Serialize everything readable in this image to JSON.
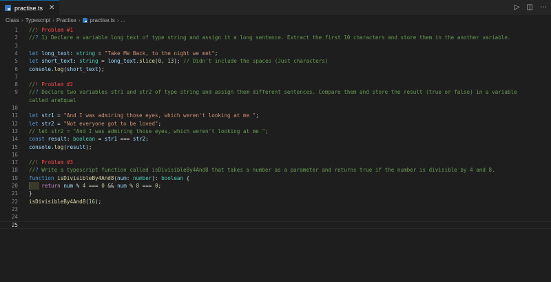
{
  "tab": {
    "label": "practise.ts",
    "close": "✕"
  },
  "breadcrumb": {
    "parts": [
      "Class",
      "Typescript",
      "Practise",
      "practise.ts",
      "..."
    ]
  },
  "colors": {
    "comment": "#6a9955",
    "keyword": "#569cd6",
    "string": "#ce9178",
    "type": "#4ec9b0",
    "function": "#dcdcaa",
    "variable": "#9cdcfe",
    "number": "#b5cea8",
    "control": "#c586c0",
    "alert": "#f44747"
  },
  "editor": {
    "active_line": 25,
    "lines": [
      {
        "n": 1,
        "tokens": [
          [
            "c",
            "//"
          ],
          [
            "b",
            "! Problem #1"
          ]
        ]
      },
      {
        "n": 2,
        "tokens": [
          [
            "c",
            "//"
          ],
          [
            "q",
            "?"
          ],
          [
            "c",
            " 1) Declare a variable long text of type string and assign it a long sentence. Extract the first 10 characters and store them in the another variable."
          ]
        ]
      },
      {
        "n": 3,
        "tokens": []
      },
      {
        "n": 4,
        "tokens": [
          [
            "k",
            "let "
          ],
          [
            "v",
            "long_text"
          ],
          [
            "p",
            ": "
          ],
          [
            "t",
            "string"
          ],
          [
            "p",
            " = "
          ],
          [
            "s",
            "\"Take Me Back, to the night we met\""
          ],
          [
            "p",
            ";"
          ]
        ]
      },
      {
        "n": 5,
        "tokens": [
          [
            "k",
            "let "
          ],
          [
            "v",
            "short_text"
          ],
          [
            "p",
            ": "
          ],
          [
            "t",
            "string"
          ],
          [
            "p",
            " = "
          ],
          [
            "v",
            "long_text"
          ],
          [
            "p",
            "."
          ],
          [
            "f",
            "slice"
          ],
          [
            "p",
            "("
          ],
          [
            "n",
            "0"
          ],
          [
            "p",
            ", "
          ],
          [
            "n",
            "13"
          ],
          [
            "p",
            "); "
          ],
          [
            "c",
            "// Didn't include the spaces (Just characters)"
          ]
        ]
      },
      {
        "n": 6,
        "tokens": [
          [
            "v",
            "console"
          ],
          [
            "p",
            "."
          ],
          [
            "f",
            "log"
          ],
          [
            "p",
            "("
          ],
          [
            "v",
            "short_text"
          ],
          [
            "p",
            ");"
          ]
        ]
      },
      {
        "n": 7,
        "tokens": []
      },
      {
        "n": 8,
        "tokens": [
          [
            "c",
            "//"
          ],
          [
            "b",
            "! Problem #2"
          ]
        ]
      },
      {
        "n": 9,
        "tokens": [
          [
            "c",
            "//"
          ],
          [
            "q",
            "?"
          ],
          [
            "c",
            " Declare two variables str1 and str2 of type string and assign them different sentences. Compare them and store the result (true or false) in a variable"
          ]
        ]
      },
      {
        "n": 0,
        "tokens": [
          [
            "c",
            "called areEqual"
          ]
        ]
      },
      {
        "n": 10,
        "tokens": []
      },
      {
        "n": 11,
        "tokens": [
          [
            "k",
            "let "
          ],
          [
            "v",
            "str1"
          ],
          [
            "p",
            " = "
          ],
          [
            "s",
            "\"And I was admiring those eyes, which weren't looking at me \""
          ],
          [
            "p",
            ";"
          ]
        ]
      },
      {
        "n": 12,
        "tokens": [
          [
            "k",
            "let "
          ],
          [
            "v",
            "str2"
          ],
          [
            "p",
            " = "
          ],
          [
            "s",
            "\"Not everyone got to be loved\""
          ],
          [
            "p",
            ";"
          ]
        ]
      },
      {
        "n": 13,
        "tokens": [
          [
            "c",
            "// let str2 = \"And I was admiring those eyes, which weren't looking at me \";"
          ]
        ]
      },
      {
        "n": 14,
        "tokens": [
          [
            "k",
            "const "
          ],
          [
            "v",
            "result"
          ],
          [
            "p",
            ": "
          ],
          [
            "t",
            "boolean"
          ],
          [
            "p",
            " = "
          ],
          [
            "v",
            "str1"
          ],
          [
            "p",
            " === "
          ],
          [
            "v",
            "str2"
          ],
          [
            "p",
            ";"
          ]
        ]
      },
      {
        "n": 15,
        "tokens": [
          [
            "v",
            "console"
          ],
          [
            "p",
            "."
          ],
          [
            "f",
            "log"
          ],
          [
            "p",
            "("
          ],
          [
            "v",
            "result"
          ],
          [
            "p",
            ");"
          ]
        ]
      },
      {
        "n": 16,
        "tokens": []
      },
      {
        "n": 17,
        "tokens": [
          [
            "c",
            "//"
          ],
          [
            "b",
            "! Problem #3"
          ]
        ]
      },
      {
        "n": 18,
        "tokens": [
          [
            "c",
            "//"
          ],
          [
            "q",
            "?"
          ],
          [
            "c",
            " Write a typescript function called isDivisibleBy4And8 that takes a number as a parameter and returns true if the number is divisible by 4 and 8."
          ]
        ]
      },
      {
        "n": 19,
        "tokens": [
          [
            "k",
            "function "
          ],
          [
            "f",
            "isDivisibleBy4And8"
          ],
          [
            "p",
            "("
          ],
          [
            "v",
            "num"
          ],
          [
            "p",
            ": "
          ],
          [
            "t",
            "number"
          ],
          [
            "p",
            "): "
          ],
          [
            "t",
            "boolean"
          ],
          [
            "p",
            " {"
          ]
        ]
      },
      {
        "n": 20,
        "tokens": [
          [
            "p",
            "    "
          ],
          [
            "x",
            "return "
          ],
          [
            "v",
            "num"
          ],
          [
            "p",
            " % "
          ],
          [
            "n",
            "4"
          ],
          [
            "p",
            " === "
          ],
          [
            "n",
            "0"
          ],
          [
            "p",
            " && "
          ],
          [
            "v",
            "num"
          ],
          [
            "p",
            " % "
          ],
          [
            "n",
            "8"
          ],
          [
            "p",
            " === "
          ],
          [
            "n",
            "0"
          ],
          [
            "p",
            ";"
          ]
        ]
      },
      {
        "n": 21,
        "tokens": [
          [
            "p",
            "}"
          ]
        ]
      },
      {
        "n": 22,
        "tokens": [
          [
            "f",
            "isDivisibleBy4And8"
          ],
          [
            "p",
            "("
          ],
          [
            "n",
            "16"
          ],
          [
            "p",
            ");"
          ]
        ]
      },
      {
        "n": 23,
        "tokens": []
      },
      {
        "n": 24,
        "tokens": []
      },
      {
        "n": 25,
        "tokens": []
      }
    ]
  }
}
